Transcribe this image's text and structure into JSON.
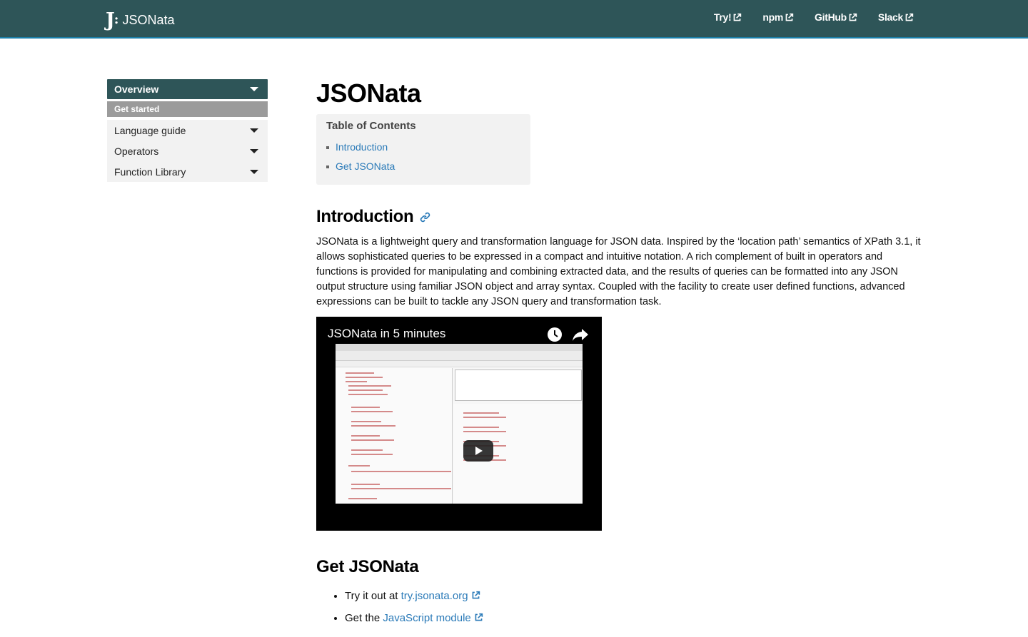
{
  "brand": {
    "logo": "J",
    "name": "JSONata"
  },
  "nav": [
    {
      "label": "Try!"
    },
    {
      "label": "npm"
    },
    {
      "label": "GitHub"
    },
    {
      "label": "Slack"
    }
  ],
  "sidebar": {
    "items": [
      {
        "label": "Overview"
      },
      {
        "label": "Get started"
      },
      {
        "label": "Language guide"
      },
      {
        "label": "Operators"
      },
      {
        "label": "Function Library"
      }
    ]
  },
  "main": {
    "title": "JSONata",
    "toc": {
      "title": "Table of Contents",
      "items": [
        "Introduction",
        "Get JSONata"
      ]
    },
    "intro": {
      "heading": "Introduction",
      "paragraph": "JSONata is a lightweight query and transformation language for JSON data. Inspired by the ‘location path’ semantics of XPath 3.1, it allows sophisticated queries to be expressed in a compact and intuitive notation. A rich complement of built in operators and functions is provided for manipulating and combining extracted data, and the results of queries can be formatted into any JSON output structure using familiar JSON object and array syntax. Coupled with the facility to create user defined functions, advanced expressions can be built to tackle any JSON query and transformation task."
    },
    "video": {
      "title": "JSONata in 5 minutes"
    },
    "get": {
      "heading": "Get JSONata",
      "items": [
        {
          "prefix": "Try it out at ",
          "link": "try.jsonata.org"
        },
        {
          "prefix": "Get the ",
          "link": "JavaScript module"
        }
      ]
    }
  },
  "colors": {
    "nav_bg": "#2e5558",
    "link": "#2a7ab8",
    "sidebar_sub": "#9b9b9b",
    "sidebar_bg": "#f2f2f2"
  }
}
